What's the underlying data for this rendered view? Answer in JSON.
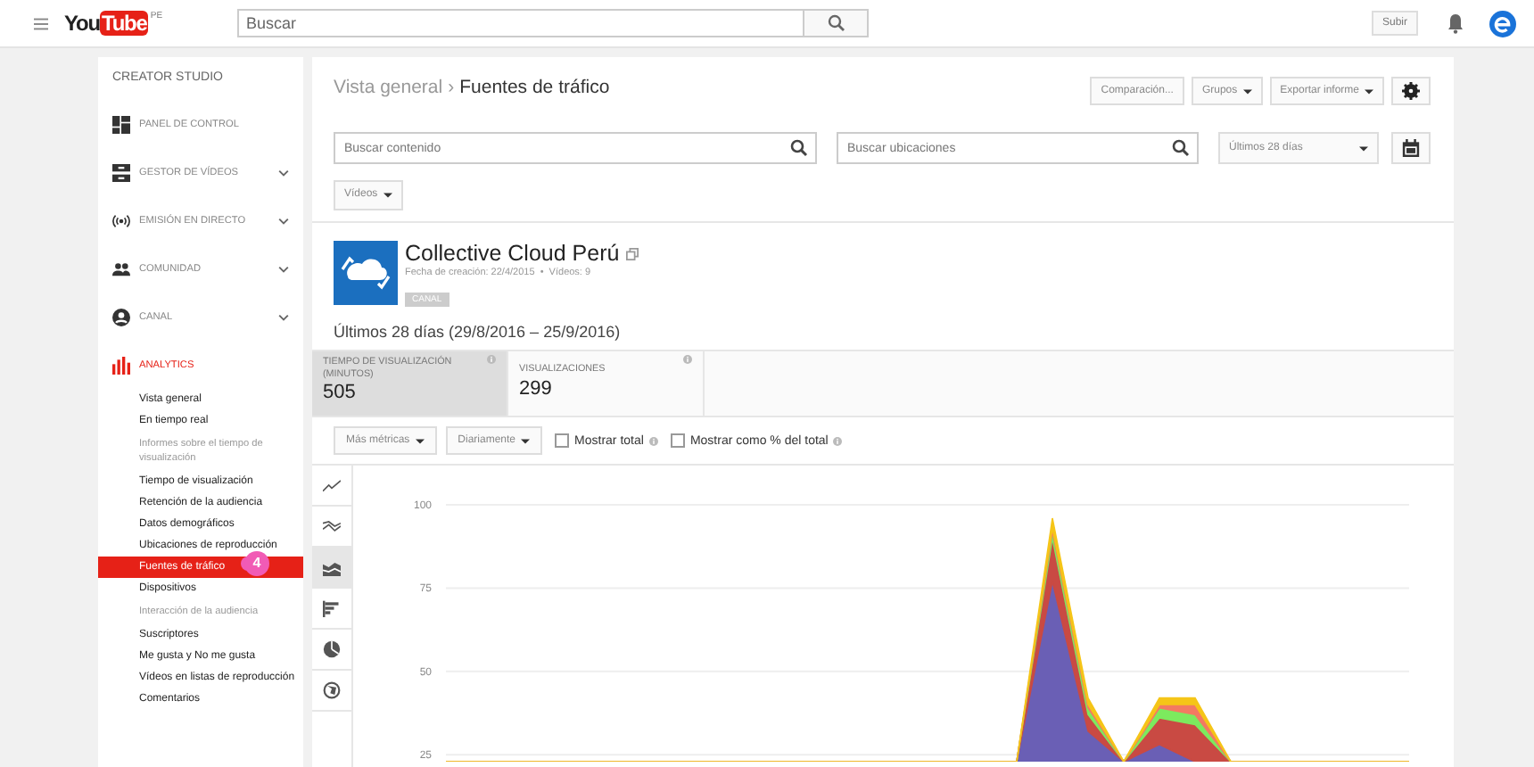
{
  "topbar": {
    "logo_left": "You",
    "logo_right": "Tube",
    "logo_region": "PE",
    "search": {
      "placeholder": "Buscar"
    },
    "upload_button": "Subir"
  },
  "sidebar": {
    "title": "CREATOR STUDIO",
    "items": [
      {
        "label": "PANEL DE CONTROL",
        "expandable": false,
        "selected": false
      },
      {
        "label": "GESTOR DE VÍDEOS",
        "expandable": true,
        "selected": false
      },
      {
        "label": "EMISIÓN EN DIRECTO",
        "expandable": true,
        "selected": false
      },
      {
        "label": "COMUNIDAD",
        "expandable": true,
        "selected": false
      },
      {
        "label": "CANAL",
        "expandable": true,
        "selected": false
      },
      {
        "label": "ANALYTICS",
        "expandable": false,
        "selected": true
      }
    ],
    "analytics_items": [
      {
        "kind": "link",
        "label": "Vista general",
        "selected": false
      },
      {
        "kind": "link",
        "label": "En tiempo real",
        "selected": false
      },
      {
        "kind": "heading",
        "label": "Informes sobre el tiempo de visualización"
      },
      {
        "kind": "link",
        "label": "Tiempo de visualización",
        "selected": false
      },
      {
        "kind": "link",
        "label": "Retención de la audiencia",
        "selected": false
      },
      {
        "kind": "link",
        "label": "Datos demográficos",
        "selected": false
      },
      {
        "kind": "link",
        "label": "Ubicaciones de reproducción",
        "selected": false
      },
      {
        "kind": "link",
        "label": "Fuentes de tráfico",
        "selected": true,
        "badge": "4"
      },
      {
        "kind": "link",
        "label": "Dispositivos",
        "selected": false
      },
      {
        "kind": "heading",
        "label": "Interacción de la audiencia"
      },
      {
        "kind": "link",
        "label": "Suscriptores",
        "selected": false
      },
      {
        "kind": "link",
        "label": "Me gusta y No me gusta",
        "selected": false
      },
      {
        "kind": "link",
        "label": "Vídeos en listas de reproducción",
        "selected": false
      },
      {
        "kind": "link",
        "label": "Comentarios",
        "selected": false
      }
    ]
  },
  "breadcrumb": {
    "parent": "Vista general",
    "separator": "›",
    "current": "Fuentes de tráfico"
  },
  "toolbar": {
    "buttons": [
      "Comparación...",
      "Grupos",
      "Exportar informe"
    ]
  },
  "filters": {
    "content_search": {
      "placeholder": "Buscar contenido"
    },
    "location_search": {
      "placeholder": "Buscar ubicaciones"
    },
    "date_range": "Últimos 28 días",
    "content_type": "Vídeos"
  },
  "channel": {
    "name": "Collective Cloud Perú",
    "meta": "Fecha de creación: 22/4/2015  •  Vídeos: 9",
    "badge": "CANAL"
  },
  "period": "Últimos 28 días (29/8/2016 – 25/9/2016)",
  "metrics": [
    {
      "label": "TIEMPO DE VISUALIZACIÓN (MINUTOS)",
      "value": "505",
      "selected": true
    },
    {
      "label": "VISUALIZACIONES",
      "value": "299",
      "selected": false
    }
  ],
  "chart_controls": {
    "metrics_button": "Más métricas",
    "interval_button": "Diariamente",
    "checkboxes": [
      {
        "label": "Mostrar total",
        "checked": false
      },
      {
        "label": "Mostrar como % del total",
        "checked": false
      }
    ]
  },
  "chart_types": [
    {
      "selected": false
    },
    {
      "selected": false
    },
    {
      "selected": true
    },
    {
      "selected": false
    },
    {
      "selected": false
    },
    {
      "selected": false
    }
  ],
  "chart": {
    "y_labels": [
      "100",
      "75",
      "50",
      "25"
    ]
  }
}
